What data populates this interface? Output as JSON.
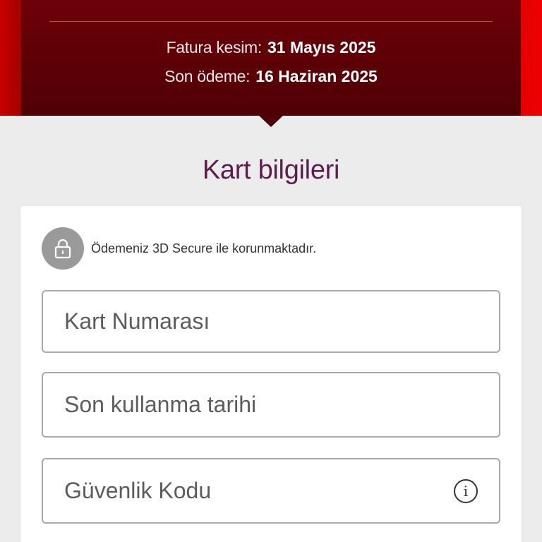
{
  "bill": {
    "cut_label": "Fatura kesim:",
    "cut_value": "31 Mayıs 2025",
    "due_label": "Son ödeme:",
    "due_value": "16 Haziran 2025"
  },
  "section_title": "Kart bilgileri",
  "secure_notice": "Ödemeniz 3D Secure ile korunmaktadır.",
  "fields": {
    "card_number_placeholder": "Kart Numarası",
    "expiry_placeholder": "Son kullanma tarihi",
    "cvv_placeholder": "Güvenlik Kodu"
  },
  "colors": {
    "header": "#5a0006",
    "accent_red": "#e60000",
    "title": "#5b1e4f"
  },
  "icons": {
    "lock": "lock-icon",
    "info": "info-icon"
  }
}
